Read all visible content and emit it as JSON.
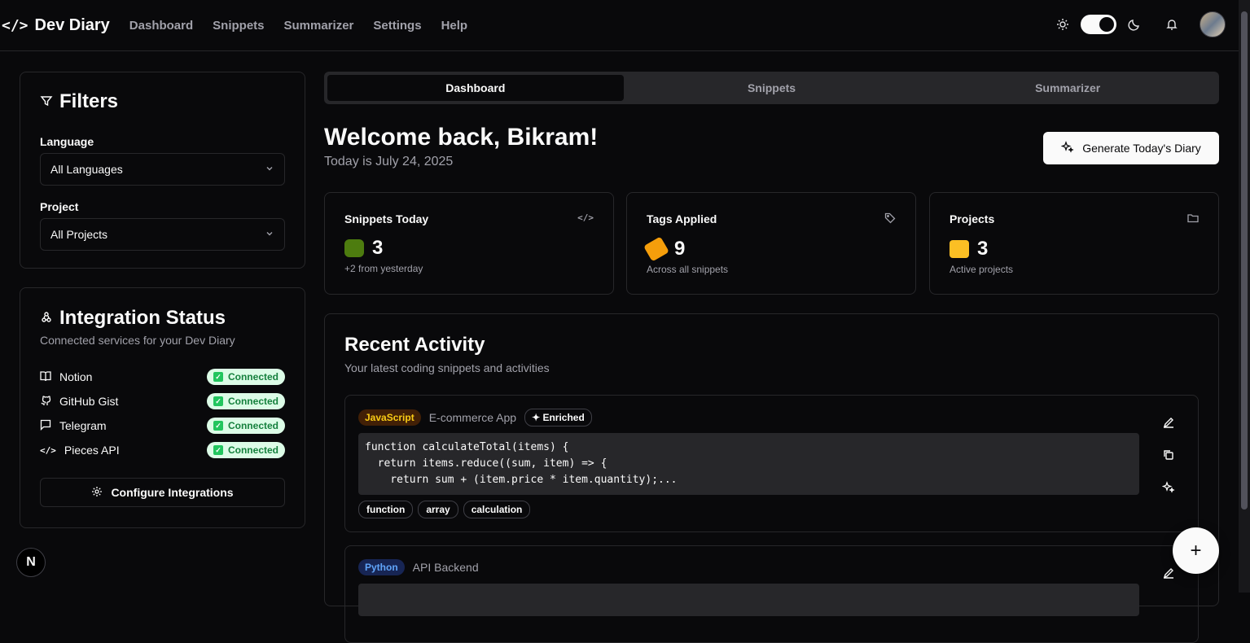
{
  "app": {
    "name": "Dev Diary",
    "nav": [
      "Dashboard",
      "Snippets",
      "Summarizer",
      "Settings",
      "Help"
    ]
  },
  "filters": {
    "title": "Filters",
    "language_label": "Language",
    "language_value": "All Languages",
    "project_label": "Project",
    "project_value": "All Projects"
  },
  "integration": {
    "title": "Integration Status",
    "subtitle": "Connected services for your Dev Diary",
    "services": [
      {
        "name": "Notion",
        "status": "Connected"
      },
      {
        "name": "GitHub Gist",
        "status": "Connected"
      },
      {
        "name": "Telegram",
        "status": "Connected"
      },
      {
        "name": "Pieces API",
        "status": "Connected"
      }
    ],
    "configure_label": "Configure Integrations"
  },
  "tabs": [
    "Dashboard",
    "Snippets",
    "Summarizer"
  ],
  "welcome": {
    "greeting": "Welcome back, Bikram!",
    "date": "Today is July 24, 2025",
    "generate_label": "Generate Today's Diary"
  },
  "stats": [
    {
      "title": "Snippets Today",
      "value": "3",
      "sub": "+2 from yesterday",
      "icon": "code-icon"
    },
    {
      "title": "Tags Applied",
      "value": "9",
      "sub": "Across all snippets",
      "icon": "tag-icon"
    },
    {
      "title": "Projects",
      "value": "3",
      "sub": "Active projects",
      "icon": "folder-icon"
    }
  ],
  "recent": {
    "title": "Recent Activity",
    "subtitle": "Your latest coding snippets and activities",
    "snippets": [
      {
        "language": "JavaScript",
        "project": "E-commerce App",
        "badge": "Enriched",
        "code": "function calculateTotal(items) {\n  return items.reduce((sum, item) => {\n    return sum + (item.price * item.quantity);...",
        "tags": [
          "function",
          "array",
          "calculation"
        ]
      },
      {
        "language": "Python",
        "project": "API Backend"
      }
    ]
  },
  "colors": {
    "background": "#09090b",
    "border": "#27272a",
    "connected_bg": "#dcfce7",
    "connected_text": "#15803d"
  }
}
